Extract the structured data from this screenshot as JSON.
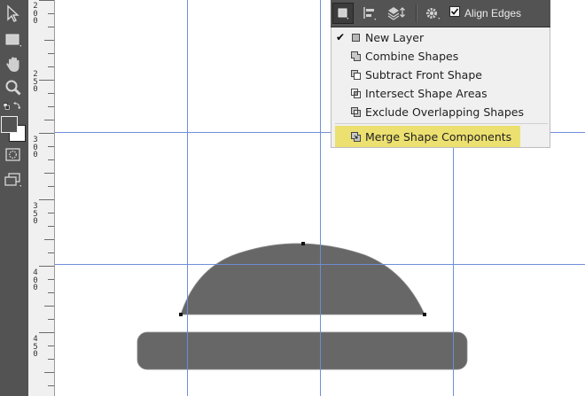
{
  "toolbar": {
    "tools": [
      {
        "icon": "move-arrow-icon"
      },
      {
        "icon": "rectangle-tool-icon"
      },
      {
        "icon": "hand-tool-icon"
      },
      {
        "icon": "zoom-tool-icon"
      },
      {
        "icon": "swap-colors-icon"
      },
      {
        "icon": "quick-mask-icon"
      },
      {
        "icon": "screen-mode-icon"
      }
    ],
    "foreground_color": "#535353",
    "background_color": "#ffffff"
  },
  "ruler": {
    "labels": [
      "200",
      "250",
      "300",
      "350",
      "400",
      "450"
    ]
  },
  "options_bar": {
    "align_edges_checked": true,
    "align_edges_label": "Align Edges"
  },
  "path_operations_menu": {
    "items": [
      {
        "label": "New Layer",
        "checked": true
      },
      {
        "label": "Combine Shapes",
        "checked": false
      },
      {
        "label": "Subtract Front Shape",
        "checked": false
      },
      {
        "label": "Intersect Shape Areas",
        "checked": false
      },
      {
        "label": "Exclude Overlapping Shapes",
        "checked": false
      },
      {
        "label": "Merge Shape Components",
        "checked": false,
        "highlighted": true
      }
    ]
  },
  "canvas": {
    "shape_fill": "#676767",
    "guide_color": "#6f8fd8",
    "background": "#ffffff"
  }
}
